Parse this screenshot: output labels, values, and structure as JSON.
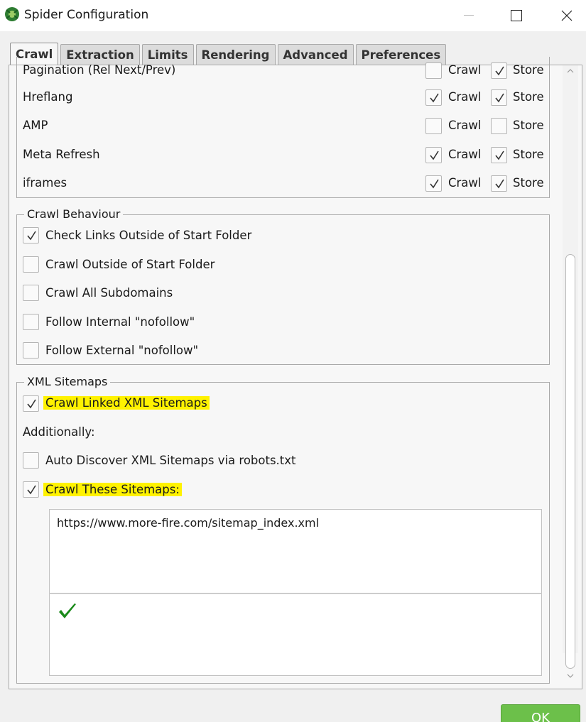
{
  "window": {
    "title": "Spider Configuration"
  },
  "tabs": [
    {
      "label": "Crawl",
      "active": true
    },
    {
      "label": "Extraction"
    },
    {
      "label": "Limits"
    },
    {
      "label": "Rendering"
    },
    {
      "label": "Advanced"
    },
    {
      "label": "Preferences"
    }
  ],
  "resource_rows": [
    {
      "label": "Pagination (Rel Next/Prev)",
      "crawl": false,
      "store": true
    },
    {
      "label": "Hreflang",
      "crawl": true,
      "store": true
    },
    {
      "label": "AMP",
      "crawl": false,
      "store": false
    },
    {
      "label": "Meta Refresh",
      "crawl": true,
      "store": true
    },
    {
      "label": "iframes",
      "crawl": true,
      "store": true
    }
  ],
  "column_labels": {
    "crawl": "Crawl",
    "store": "Store"
  },
  "crawl_behaviour": {
    "title": "Crawl Behaviour",
    "options": [
      {
        "label": "Check Links Outside of Start Folder",
        "checked": true
      },
      {
        "label": "Crawl Outside of Start Folder",
        "checked": false
      },
      {
        "label": "Crawl All Subdomains",
        "checked": false
      },
      {
        "label": "Follow Internal \"nofollow\"",
        "checked": false
      },
      {
        "label": "Follow External \"nofollow\"",
        "checked": false
      }
    ]
  },
  "xml_sitemaps": {
    "title": "XML Sitemaps",
    "crawl_linked": {
      "label": "Crawl Linked XML Sitemaps",
      "checked": true
    },
    "additionally": "Additionally:",
    "auto_discover": {
      "label": "Auto Discover XML Sitemaps via robots.txt",
      "checked": false
    },
    "crawl_these": {
      "label": "Crawl These Sitemaps:",
      "checked": true
    },
    "sitemap_urls": "https://www.more-fire.com/sitemap_index.xml",
    "validation_status": "valid"
  },
  "buttons": {
    "ok": "OK"
  },
  "colors": {
    "highlight": "#fff200",
    "ok_green": "#6cc04a",
    "valid_check": "#1a8a1a"
  }
}
